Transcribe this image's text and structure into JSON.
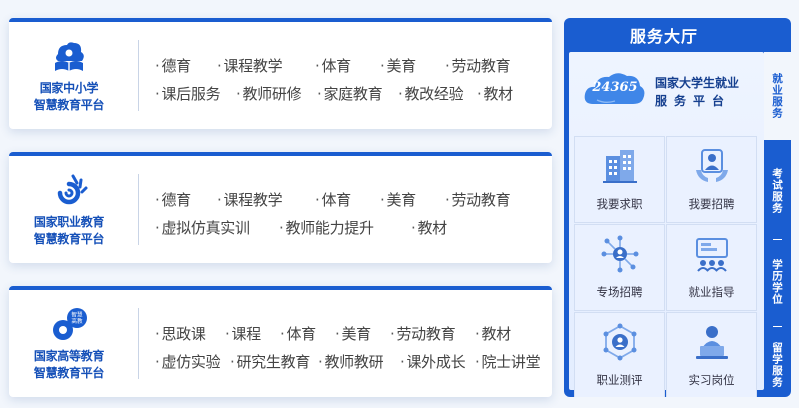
{
  "platforms": [
    {
      "logo_icon": "zhongxiaoxue-book-logo-icon",
      "name_line1": "国家中小学",
      "name_line2": "智慧教育平台",
      "rows": [
        [
          "德育",
          "课程教学",
          "体育",
          "美育",
          "劳动教育"
        ],
        [
          "课后服务",
          "教师研修",
          "家庭教育",
          "教改经验",
          "教材"
        ]
      ]
    },
    {
      "logo_icon": "zhiye-swirl-logo-icon",
      "name_line1": "国家职业教育",
      "name_line2": "智慧教育平台",
      "rows": [
        [
          "德育",
          "课程教学",
          "体育",
          "美育",
          "劳动教育"
        ],
        [
          "虚拟仿真实训",
          "教师能力提升",
          "教材"
        ]
      ]
    },
    {
      "logo_icon": "gaodeng-gear-logo-icon",
      "logo_text": "智慧高教",
      "name_line1": "国家高等教育",
      "name_line2": "智慧教育平台",
      "rows": [
        [
          "思政课",
          "课程",
          "体育",
          "美育",
          "劳动教育",
          "教材"
        ],
        [
          "虚仿实验",
          "研究生教育",
          "教师教研",
          "课外成长",
          "院士讲堂"
        ]
      ]
    }
  ],
  "service_hall": {
    "title": "服务大厅",
    "brand": {
      "badge": "24365",
      "line1": "国家大学生就业",
      "line2": "服务平台"
    },
    "tiles": [
      {
        "label": "我要求职",
        "icon": "building-icon"
      },
      {
        "label": "我要招聘",
        "icon": "recruiter-hands-icon"
      },
      {
        "label": "专场招聘",
        "icon": "network-people-icon"
      },
      {
        "label": "就业指导",
        "icon": "presentation-icon"
      },
      {
        "label": "职业测评",
        "icon": "assessment-network-icon"
      },
      {
        "label": "实习岗位",
        "icon": "laptop-worker-icon"
      }
    ],
    "side_tabs": [
      "就业服务",
      "考试服务",
      "学历学位",
      "留学服务"
    ],
    "active_tab": "就业服务"
  },
  "colors": {
    "brand_blue": "#1a5dd0",
    "logo_blue": "#1550b8",
    "text": "#444444"
  }
}
